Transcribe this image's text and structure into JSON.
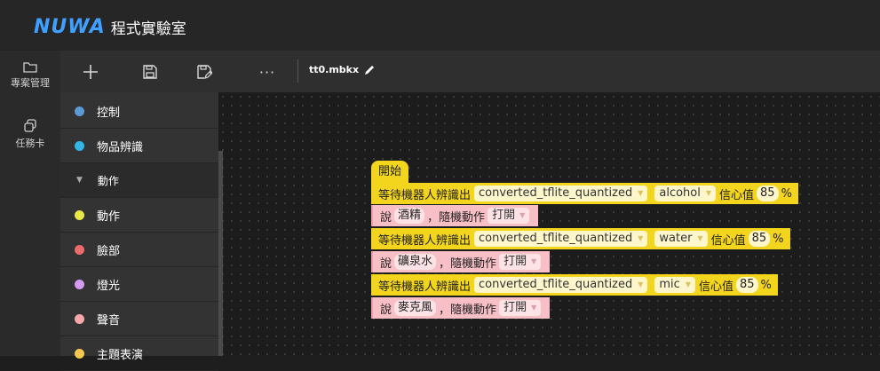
{
  "app": {
    "logo_mark": "NUWA",
    "title": "程式實驗室"
  },
  "leftnav": [
    {
      "label": "專案管理",
      "icon": "folder-icon"
    },
    {
      "label": "任務卡",
      "icon": "cards-icon"
    }
  ],
  "toolbar": {
    "add": "new-icon",
    "save": "save-icon",
    "save_as": "save-as-icon",
    "more": "···",
    "filename": "tt0.mbkx"
  },
  "palette": [
    {
      "label": "控制",
      "color": "#5b9bd5"
    },
    {
      "label": "物品辨識",
      "color": "#33b5e5"
    },
    {
      "label": "動作",
      "sub": true
    },
    {
      "label": "動作",
      "color": "#e8e84a"
    },
    {
      "label": "臉部",
      "color": "#ee6b6b"
    },
    {
      "label": "燈光",
      "color": "#d49cf0"
    },
    {
      "label": "聲音",
      "color": "#f6a8a8"
    },
    {
      "label": "主題表演",
      "color": "#f5c850"
    }
  ],
  "blocks": {
    "start": "開始",
    "wait1": {
      "label": "等待機器人辨識出",
      "model": "converted_tflite_quantized",
      "item": "alcohol",
      "conf_label": "信心值",
      "conf": "85",
      "unit": "%"
    },
    "say1": {
      "label": "說",
      "text": "酒精",
      "sep": "，",
      "action_label": "隨機動作",
      "action": "打開"
    },
    "wait2": {
      "label": "等待機器人辨識出",
      "model": "converted_tflite_quantized",
      "item": "water",
      "conf_label": "信心值",
      "conf": "85",
      "unit": "%"
    },
    "say2": {
      "label": "說",
      "text": "礦泉水",
      "sep": "，",
      "action_label": "隨機動作",
      "action": "打開"
    },
    "wait3": {
      "label": "等待機器人辨識出",
      "model": "converted_tflite_quantized",
      "item": "mic",
      "conf_label": "信心值",
      "conf": "85",
      "unit": "%"
    },
    "say3": {
      "label": "說",
      "text": "麥克風",
      "sep": "，",
      "action_label": "隨機動作",
      "action": "打開"
    }
  }
}
